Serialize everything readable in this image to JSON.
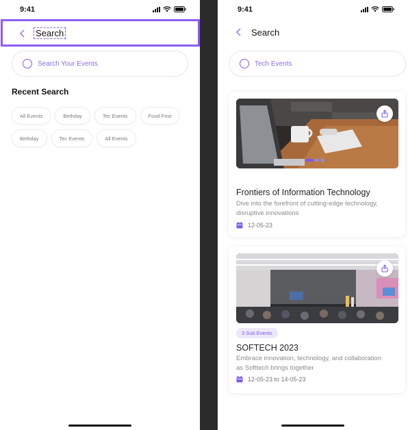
{
  "colors": {
    "accent": "#7c5cf0",
    "selection": "#8b5cf6",
    "badge_bg": "#ede7fb"
  },
  "left": {
    "status": {
      "time": "9:41"
    },
    "header": {
      "back_icon": "chevron-left-icon",
      "title": "Search"
    },
    "search": {
      "placeholder": "Search Your Events"
    },
    "recent": {
      "title": "Recent Search",
      "row1": [
        "All Events",
        "Birthday",
        "Tec Events",
        "Food Fest"
      ],
      "row2": [
        "Birthday",
        "Tec Events",
        "All Events"
      ]
    }
  },
  "right": {
    "status": {
      "time": "9:41"
    },
    "header": {
      "back_icon": "chevron-left-icon",
      "title": "Search"
    },
    "search": {
      "value": "Tech Events"
    },
    "cards": [
      {
        "title": "Frontiers of Information Technology",
        "description": "Dive into the forefront of cutting-edge technology, disruptive innovations",
        "date": "12-05-23",
        "image": "laptop-coffee-desk-photo"
      },
      {
        "badge": "3 Sub Events",
        "title": "SOFTECH 2023",
        "description": "Embrace innovation, technology, and collaboration as Softtech brings together",
        "date": "12-05-23 to 14-05-23",
        "image": "conference-hall-photo"
      }
    ]
  }
}
